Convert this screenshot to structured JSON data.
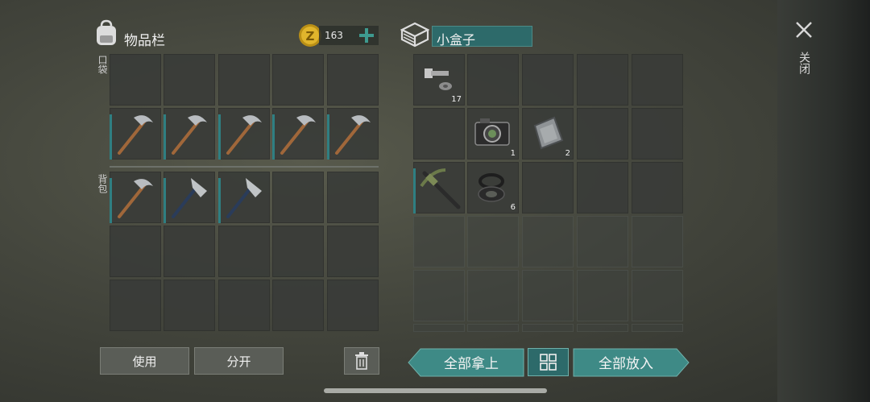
{
  "inventory": {
    "title": "物品栏",
    "currency": "163",
    "sections": {
      "pocket": "口袋",
      "backpack": "背包"
    }
  },
  "container": {
    "name": "小盒子",
    "items": [
      {
        "name": "bolt-and-nut",
        "qty": "17"
      },
      {
        "name": "camera",
        "qty": "1"
      },
      {
        "name": "metal-plate",
        "qty": "2"
      },
      {
        "name": "crossbow",
        "qty": ""
      },
      {
        "name": "rubber-seal",
        "qty": "6"
      }
    ]
  },
  "buttons": {
    "use": "使用",
    "split": "分开",
    "take_all": "全部拿上",
    "put_all": "全部放入",
    "close": "关闭"
  },
  "colors": {
    "accent": "#2f7f82",
    "teal_button": "#3e8a86",
    "name_field": "#2d6a6a"
  }
}
